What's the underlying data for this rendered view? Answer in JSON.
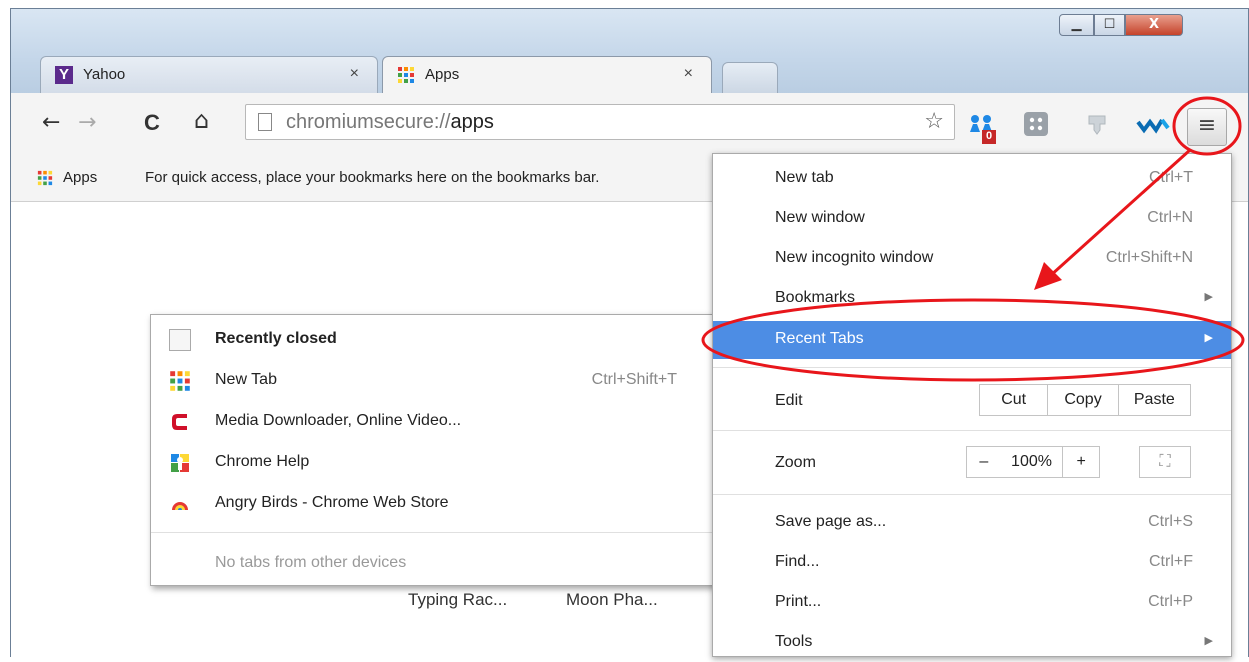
{
  "window": {
    "controls": {
      "minimize": "▁",
      "maximize": "☐",
      "close": "X"
    }
  },
  "tabs": [
    {
      "title": "Yahoo",
      "close": "×"
    },
    {
      "title": "Apps",
      "close": "×"
    }
  ],
  "toolbar": {
    "back": "←",
    "forward": "→",
    "reload": "C",
    "home": "⌂",
    "url_scheme": "chromiumsecure://",
    "url_path": "apps",
    "star": "☆",
    "menu_icon": "≡",
    "ext_badge": "0"
  },
  "bookmarks_bar": {
    "apps_label": "Apps",
    "hint": "For quick access, place your bookmarks here on the bookmarks bar."
  },
  "page": {
    "apps": [
      "Typing Rac...",
      "Moon Pha..."
    ]
  },
  "menu": {
    "items": [
      {
        "label": "New tab",
        "shortcut": "Ctrl+T"
      },
      {
        "label": "New window",
        "shortcut": "Ctrl+N"
      },
      {
        "label": "New incognito window",
        "shortcut": "Ctrl+Shift+N"
      },
      {
        "label": "Bookmarks",
        "submenu": "▶"
      },
      {
        "label": "Recent Tabs",
        "submenu": "▶"
      }
    ],
    "edit": {
      "label": "Edit",
      "cut": "Cut",
      "copy": "Copy",
      "paste": "Paste"
    },
    "zoom": {
      "label": "Zoom",
      "minus": "–",
      "level": "100%",
      "plus": "+",
      "fullscreen": "⛶"
    },
    "items2": [
      {
        "label": "Save page as...",
        "shortcut": "Ctrl+S"
      },
      {
        "label": "Find...",
        "shortcut": "Ctrl+F"
      },
      {
        "label": "Print...",
        "shortcut": "Ctrl+P"
      },
      {
        "label": "Tools",
        "submenu": "▶"
      }
    ]
  },
  "recent_tabs": {
    "header": "Recently closed",
    "items": [
      {
        "label": "New Tab",
        "shortcut": "Ctrl+Shift+T",
        "icon": "apps-grid-icon"
      },
      {
        "label": "Media Downloader, Online Video...",
        "icon": "media-downloader-icon"
      },
      {
        "label": "Chrome Help",
        "icon": "chrome-help-icon"
      },
      {
        "label": "Angry Birds - Chrome Web Store",
        "icon": "angry-birds-icon"
      }
    ],
    "other_devices": "No tabs from other devices"
  },
  "colors": {
    "highlight": "#4d8de4",
    "annotation": "#e8161b"
  }
}
